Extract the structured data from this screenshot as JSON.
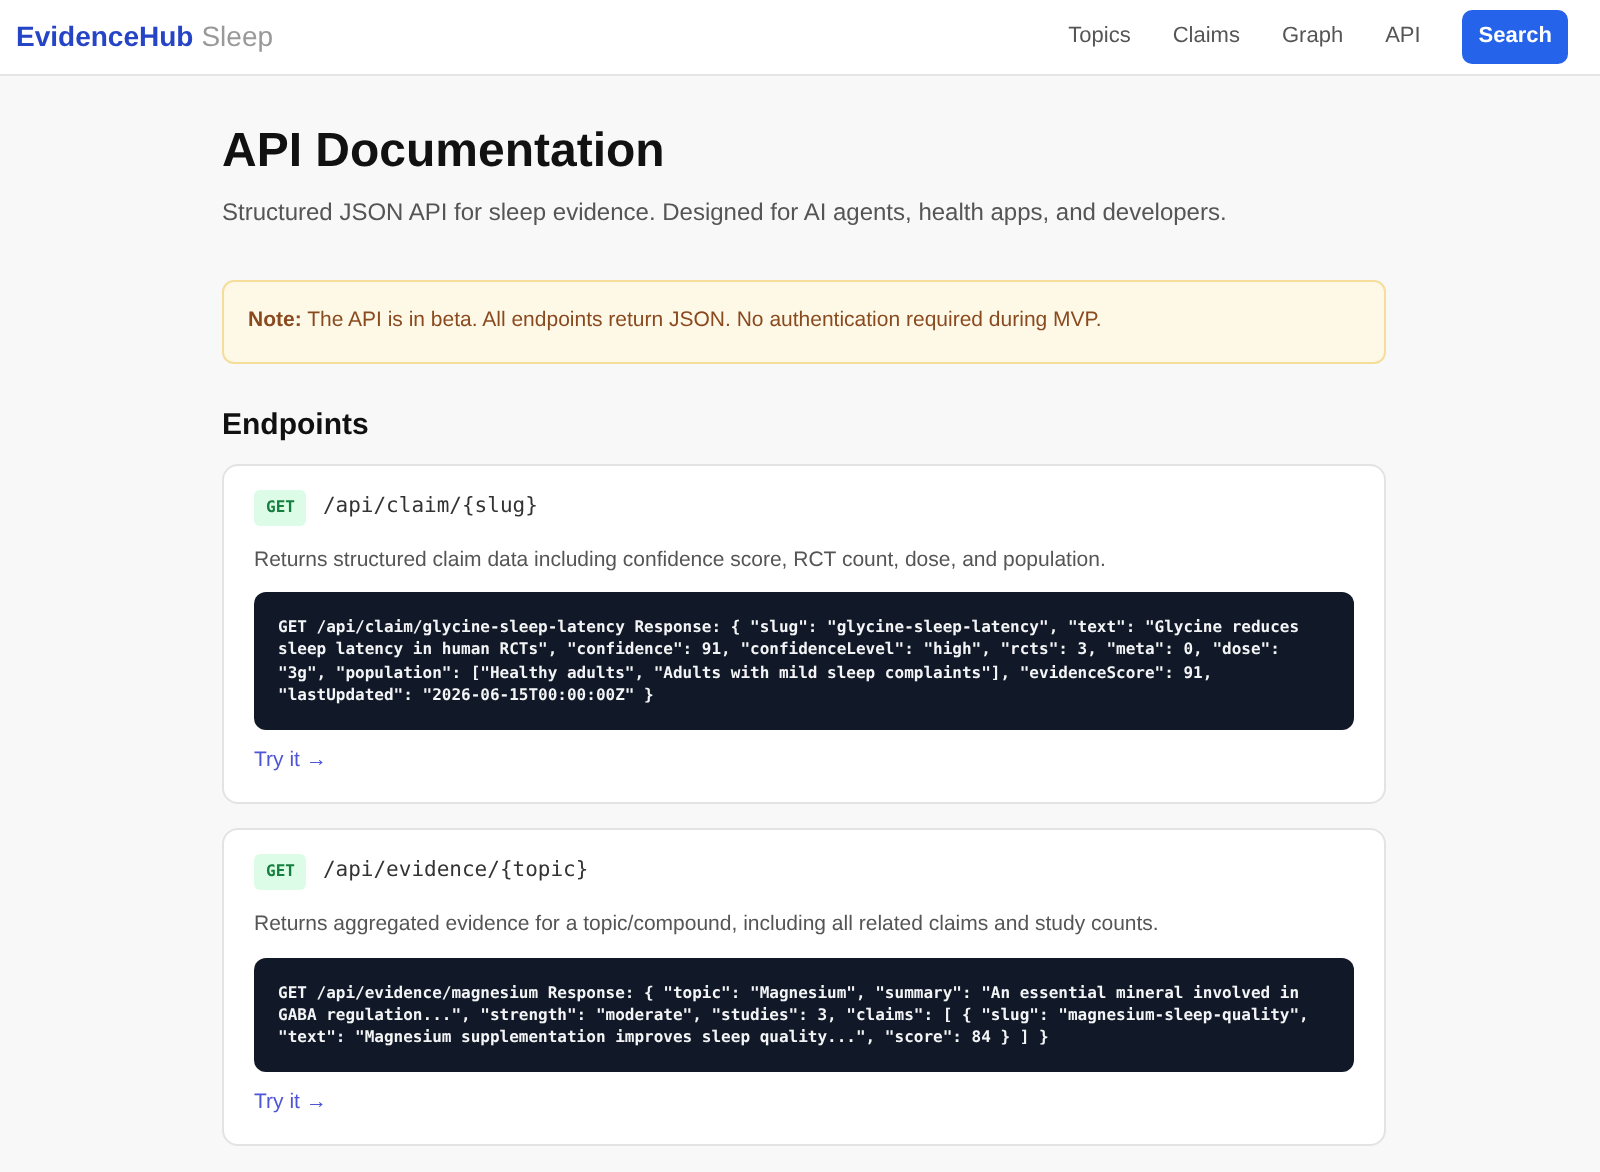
{
  "navbar": {
    "brand": "EvidenceHub",
    "brand_suffix": "Sleep",
    "links": [
      "Topics",
      "Claims",
      "Graph",
      "API"
    ],
    "search_button": "Search"
  },
  "page": {
    "title": "API Documentation",
    "subtitle": "Structured JSON API for sleep evidence. Designed for AI agents, health apps, and developers."
  },
  "note": "**Note:** The API is in beta. All endpoints return JSON. No authentication required during MVP.",
  "endpoints_heading": "Endpoints",
  "endpoints": [
    {
      "method": "GET",
      "path": "/api/claim/{slug}",
      "description": "Returns structured claim data including confidence score, RCT count, dose, and population.",
      "example": "GET /api/claim/glycine-sleep-latency Response: { \"slug\": \"glycine-sleep-latency\", \"text\": \"Glycine reduces sleep latency in human RCTs\", \"confidence\": 91, \"confidenceLevel\": \"high\", \"rcts\": 3, \"meta\": 0, \"dose\": \"3g\", \"population\": [\"Healthy adults\", \"Adults with mild sleep complaints\"], \"evidenceScore\": 91, \"lastUpdated\": \"2026-06-15T00:00:00Z\" }",
      "link": "Try it →"
    },
    {
      "method": "GET",
      "path": "/api/evidence/{topic}",
      "description": "Returns aggregated evidence for a topic/compound, including all related claims and study counts.",
      "example": "GET /api/evidence/magnesium Response: { \"topic\": \"Magnesium\", \"summary\": \"An essential mineral involved in GABA regulation...\", \"strength\": \"moderate\", \"studies\": 3, \"claims\": [ { \"slug\": \"magnesium-sleep-quality\", \"text\": \"Magnesium supplementation improves sleep quality...\", \"score\": 84 } ] }",
      "link": "Try it →"
    }
  ]
}
